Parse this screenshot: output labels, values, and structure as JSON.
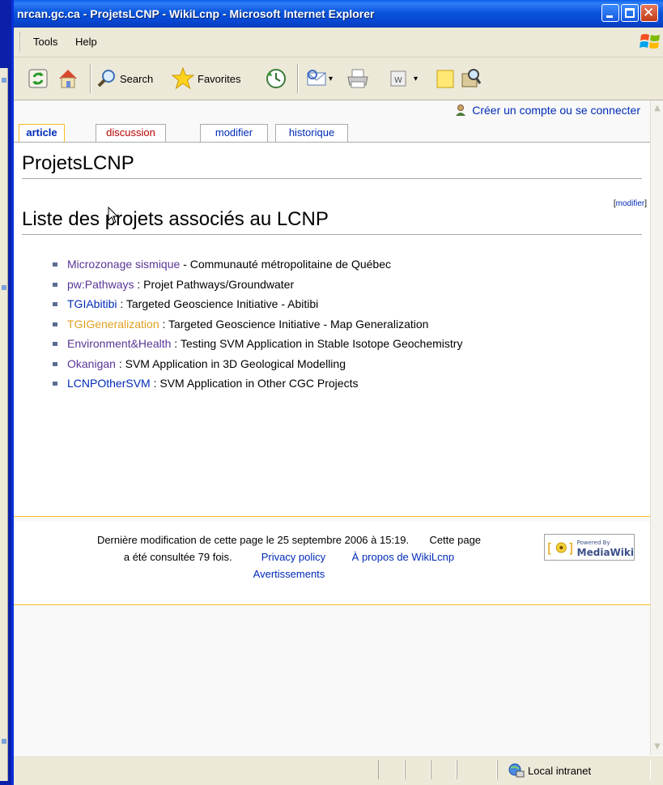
{
  "window": {
    "title": "nrcan.gc.ca - ProjetsLCNP - WikiLcnp - Microsoft Internet Explorer"
  },
  "menubar": {
    "items": [
      "Tools",
      "Help"
    ]
  },
  "toolbar": {
    "search_label": "Search",
    "favorites_label": "Favorites"
  },
  "page": {
    "user_link": "Créer un compte ou se connecter",
    "tabs": [
      {
        "label": "article",
        "selected": true
      },
      {
        "label": "discussion",
        "selected": false
      },
      {
        "label": "modifier",
        "selected": false
      },
      {
        "label": "historique",
        "selected": false
      }
    ],
    "heading": "ProjetsLCNP",
    "section_heading": "Liste des projets associés au LCNP",
    "edit_bracket_open": "[",
    "edit_link": "modifier",
    "edit_bracket_close": "]",
    "projects": [
      {
        "link": "Microzonage sismique",
        "sep": " - ",
        "desc": "Communauté métropolitaine de Québec",
        "color": "#5a3696"
      },
      {
        "link": "pw:Pathways",
        "sep": " : ",
        "desc": "Projet Pathways/Groundwater",
        "color": "#5a3696"
      },
      {
        "link": "TGIAbitibi",
        "sep": " : ",
        "desc": "Targeted Geoscience Initiative - Abitibi",
        "color": "#002bb8"
      },
      {
        "link": "TGIGeneralization",
        "sep": " : ",
        "desc": "Targeted Geoscience Initiative - Map Generalization",
        "color": "#e0a020"
      },
      {
        "link": "Environment&Health",
        "sep": " : ",
        "desc": "Testing SVM Application in Stable Isotope Geochemistry",
        "color": "#5a3696"
      },
      {
        "link": "Okanigan",
        "sep": " : ",
        "desc": "SVM Application in 3D Geological Modelling",
        "color": "#5a3696"
      },
      {
        "link": "LCNPOtherSVM",
        "sep": " : ",
        "desc": "SVM Application in Other CGC Projects",
        "color": "#002bb8"
      }
    ]
  },
  "footer": {
    "last_modified": "Dernière modification de cette page le 25 septembre 2006 à 15:19.",
    "views_prefix": "Cette page",
    "views": "a été consultée 79 fois.",
    "privacy": "Privacy policy",
    "about": "À propos de WikiLcnp",
    "disclaimers": "Avertissements",
    "badge_powered": "Powered By",
    "badge_name": "MediaWiki"
  },
  "statusbar": {
    "zone": "Local intranet"
  }
}
